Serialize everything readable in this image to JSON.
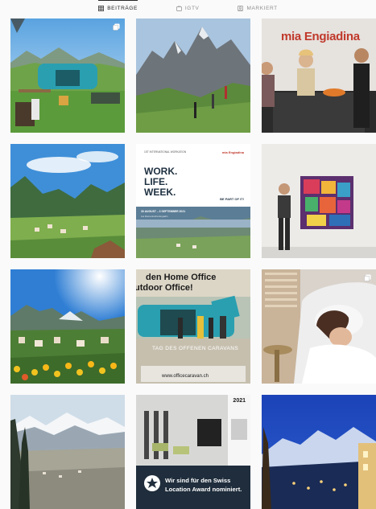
{
  "tabs": [
    {
      "label": "BEITRÄGE",
      "icon": "grid-icon",
      "active": true
    },
    {
      "label": "IGTV",
      "icon": "igtv-icon",
      "active": false
    },
    {
      "label": "MARKIERT",
      "icon": "tag-icon",
      "active": false
    }
  ],
  "posts": {
    "p3": {
      "logo": "mia Engiadina"
    },
    "p5": {
      "logo": "mia Engiadina",
      "intro": "1ST INTERNATIONAL WORKATION",
      "title_lines": [
        "WORK.",
        "LIFE.",
        "WEEK."
      ],
      "body": "",
      "part": "BE PART OF IT!",
      "date": "30 AUGUST – 3 SEPTEMBER 2021",
      "location": "Lia Rumantscha Engadin"
    },
    "p8": {
      "headline_1": "den Home Office",
      "headline_2": "utdoor Office!",
      "tagline": "TAG DES OFFENEN CARAVANS",
      "url": "www.officecaravan.ch"
    },
    "p11": {
      "year": "2021",
      "award_line_1": "Wir sind für den Swiss",
      "award_line_2": "Location Award nominiert."
    }
  },
  "colors": {
    "tab_active": "#262626",
    "tab_inactive": "#8e8e8e",
    "background": "#fafafa"
  }
}
